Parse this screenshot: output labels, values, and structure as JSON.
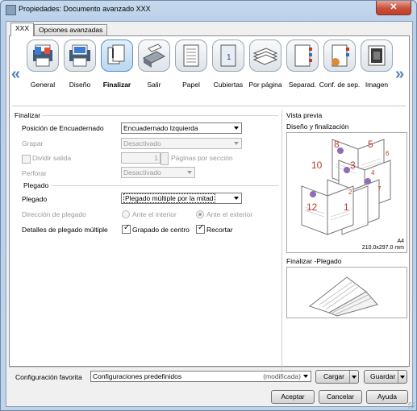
{
  "window": {
    "title": "Propiedades: Documento avanzado XXX",
    "close_label": "✕"
  },
  "tabs": [
    {
      "label": "XXX"
    },
    {
      "label": "Opciones avanzadas"
    }
  ],
  "nav": {
    "prev": "«",
    "next": "»"
  },
  "categories": [
    {
      "label": "General",
      "icon": "printer-general-icon"
    },
    {
      "label": "Diseño",
      "icon": "layout-icon"
    },
    {
      "label": "Finalizar",
      "icon": "finishing-icon",
      "selected": true
    },
    {
      "label": "Salir",
      "icon": "output-tray-icon"
    },
    {
      "label": "Papel",
      "icon": "paper-icon"
    },
    {
      "label": "Cubiertas",
      "icon": "covers-icon"
    },
    {
      "label": "Por página",
      "icon": "per-page-icon"
    },
    {
      "label": "Separad.",
      "icon": "separator-icon"
    },
    {
      "label": "Conf. de sep.",
      "icon": "separator-settings-icon"
    },
    {
      "label": "Imagen",
      "icon": "image-icon"
    }
  ],
  "finalizar": {
    "section_title": "Finalizar",
    "binding_label": "Posición de Encuadernado",
    "binding_value": "Encuadernado Izquierda",
    "staple_label": "Grapar",
    "staple_value": "Desactivado",
    "split_label": "Dividir salida",
    "split_value": "1",
    "split_suffix": "Páginas por sección",
    "punch_label": "Perforar",
    "punch_value": "Desactivado"
  },
  "plegado": {
    "section_title": "Plegado",
    "fold_label": "Plegado",
    "fold_value": "Plegado múltiple por la mitad",
    "direction_label": "Dirección de plegado",
    "direction_inside": "Ante el interior",
    "direction_outside": "Ante el exterior",
    "details_label": "Detalles de plegado múltiple",
    "center_staple_label": "Grapado de centro",
    "trim_label": "Recortar"
  },
  "preview": {
    "title": "Vista previa",
    "layout_label": "Diseño y finalización",
    "paper_size": "A4",
    "paper_dims": "210.0x297.0 mm",
    "fold_label": "Finalizar -Plegado",
    "page_numbers": [
      "8",
      "5",
      "6",
      "10",
      "3",
      "4",
      "12",
      "1",
      "2",
      "7"
    ]
  },
  "favorites": {
    "label": "Configuración favorita",
    "value": "Configuraciones predefinidos",
    "modified": "(modificada)",
    "load_label": "Cargar",
    "save_label": "Guardar"
  },
  "buttons": {
    "ok": "Aceptar",
    "cancel": "Cancelar",
    "help": "Ayuda"
  },
  "colors": {
    "accent": "#4f81bd",
    "page_number": "#c0392b",
    "window_frame": "#bfd3ea"
  }
}
